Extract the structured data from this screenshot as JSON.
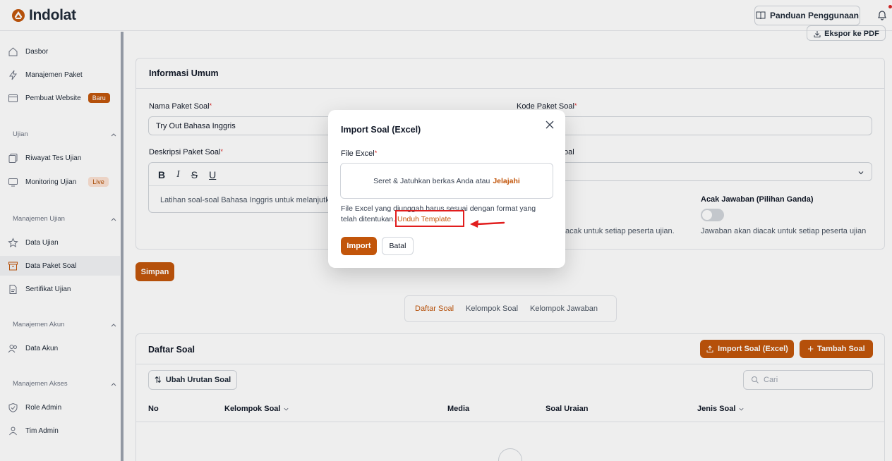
{
  "brand": {
    "name": "Indolat",
    "accent": "#c2550a"
  },
  "header": {
    "guide_label": "Panduan Penggunaan"
  },
  "sidebar": {
    "items": [
      {
        "label": "Dasbor",
        "icon": "home-icon"
      },
      {
        "label": "Manajemen Paket",
        "icon": "bolt-icon"
      },
      {
        "label": "Pembuat Website",
        "icon": "browser-icon",
        "badge": "Baru"
      }
    ],
    "sections": [
      {
        "title": "Ujian",
        "items": [
          {
            "label": "Riwayat Tes Ujian",
            "icon": "copy-icon"
          },
          {
            "label": "Monitoring Ujian",
            "icon": "monitor-icon",
            "badge": "Live"
          }
        ]
      },
      {
        "title": "Manajemen Ujian",
        "items": [
          {
            "label": "Data Ujian",
            "icon": "star-icon"
          },
          {
            "label": "Data Paket Soal",
            "icon": "archive-icon",
            "active": true
          },
          {
            "label": "Sertifikat Ujian",
            "icon": "file-icon"
          }
        ]
      },
      {
        "title": "Manajemen Akun",
        "items": [
          {
            "label": "Data Akun",
            "icon": "users-icon"
          }
        ]
      },
      {
        "title": "Manajemen Akses",
        "items": [
          {
            "label": "Role Admin",
            "icon": "shield-icon"
          },
          {
            "label": "Tim Admin",
            "icon": "team-icon"
          }
        ]
      }
    ]
  },
  "main": {
    "export_label": "Ekspor ke PDF",
    "info": {
      "title": "Informasi Umum",
      "name_label": "Nama Paket Soal",
      "name_value": "Try Out Bahasa Inggris",
      "code_label": "Kode Paket Soal",
      "desc_label": "Deskripsi Paket Soal",
      "desc_value": "Latihan soal-soal Bahasa Inggris untuk melanjutk",
      "type_label_fragment": "oal",
      "shuffle_q_desc_fragment": "acak untuk setiap peserta ujian.",
      "shuffle_a_label": "Acak Jawaban (Pilihan Ganda)",
      "shuffle_a_desc": "Jawaban akan diacak untuk setiap peserta ujian"
    },
    "save_label": "Simpan",
    "tabs": [
      "Daftar Soal",
      "Kelompok Soal",
      "Kelompok Jawaban"
    ],
    "questions": {
      "title": "Daftar Soal",
      "import_label": "Import Soal (Excel)",
      "add_label": "Tambah Soal",
      "sort_label": "Ubah Urutan Soal",
      "search_placeholder": "Cari",
      "columns": [
        "No",
        "Kelompok Soal",
        "Media",
        "Soal Uraian",
        "Jenis Soal"
      ]
    }
  },
  "modal": {
    "title": "Import Soal (Excel)",
    "file_label": "File Excel",
    "dropzone_text": "Seret & Jatuhkan berkas Anda atau",
    "browse_label": "Jelajahi",
    "note_text": "File Excel yang diunggah harus sesuai dengan format yang telah ditentukan.",
    "template_link": "Unduh Template",
    "import_label": "Import",
    "cancel_label": "Batal"
  }
}
